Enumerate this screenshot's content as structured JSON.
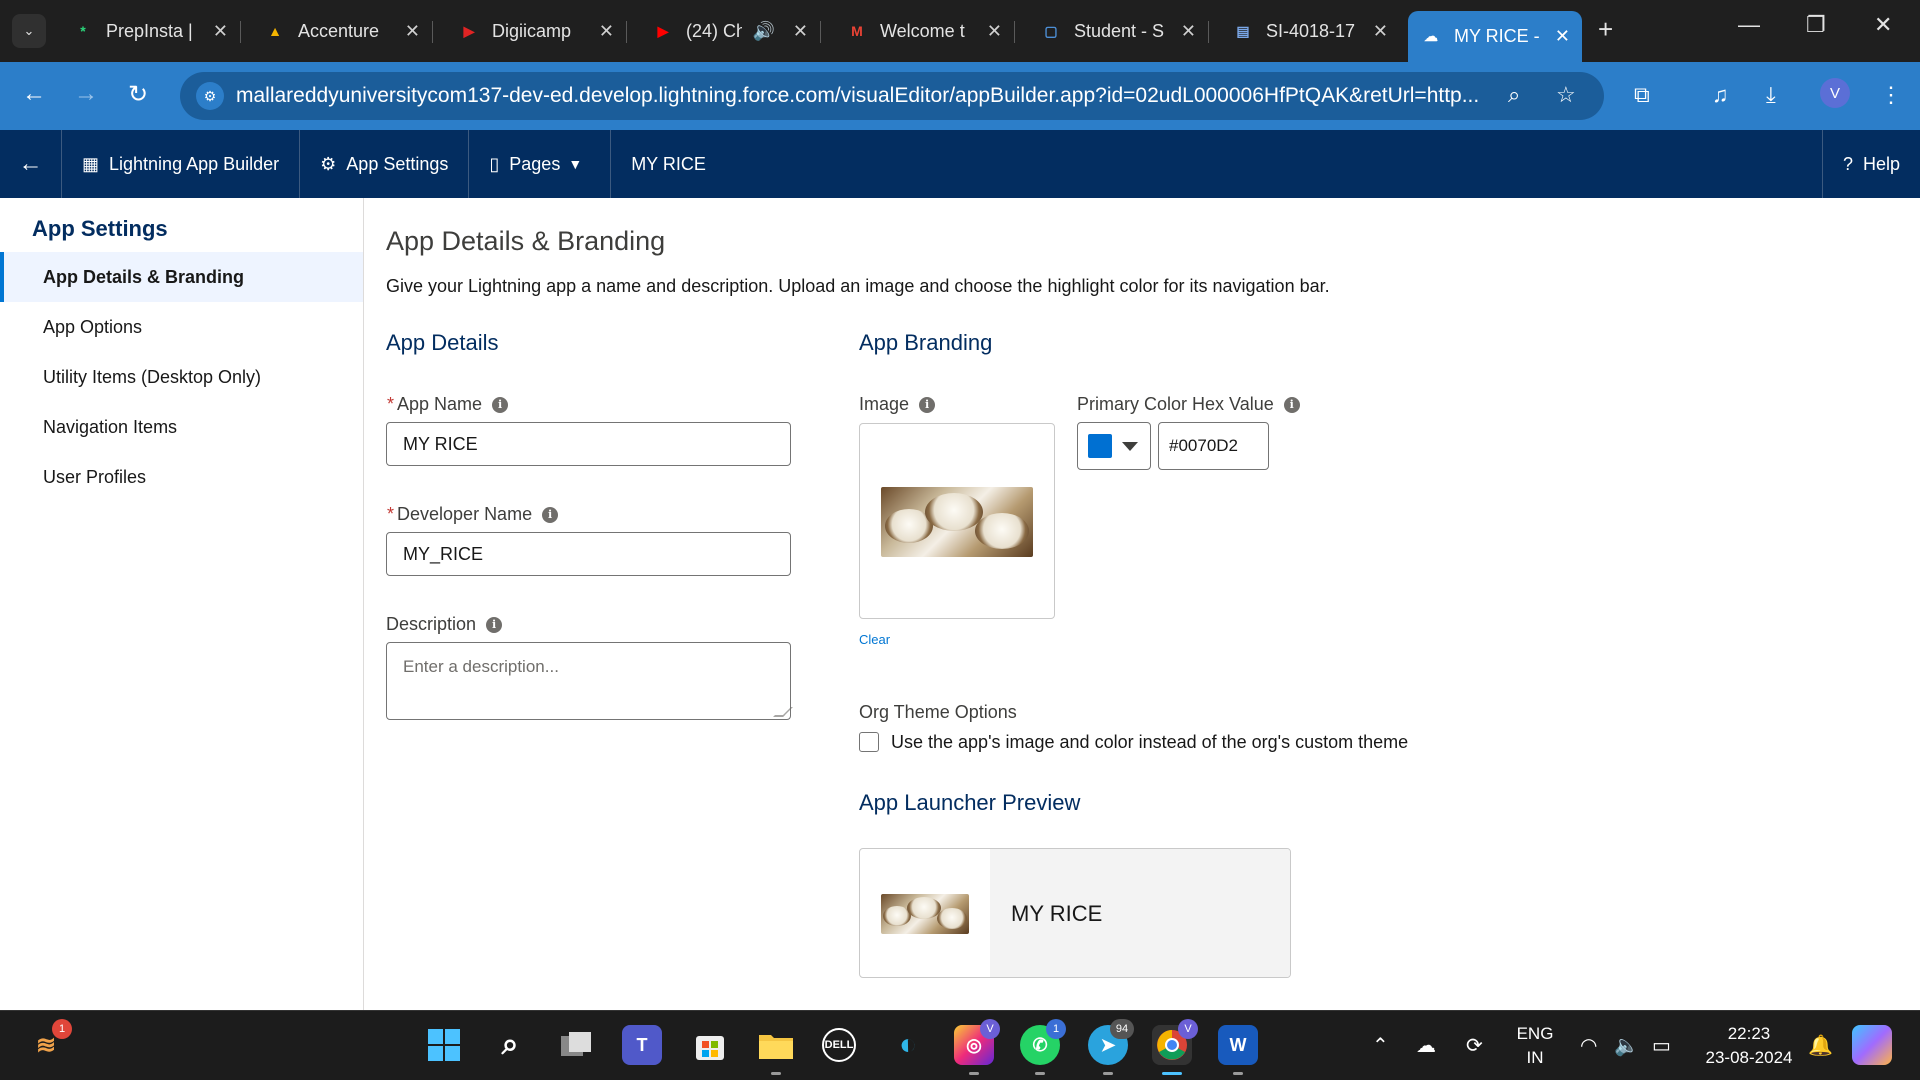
{
  "browser": {
    "tabs": [
      {
        "title": "PrepInsta |",
        "favicon": "*",
        "color": "#2bd67b"
      },
      {
        "title": "Accenture",
        "favicon": "▲",
        "color": "#f4b400"
      },
      {
        "title": "Digiicamp",
        "favicon": "▶",
        "color": "#e02424"
      },
      {
        "title": "(24) Ch",
        "favicon": "▶",
        "color": "#ff0000"
      },
      {
        "title": "Welcome t",
        "favicon": "M",
        "color": "#ea4335"
      },
      {
        "title": "Student - S",
        "favicon": "▢",
        "color": "#4d8fd6"
      },
      {
        "title": "SI-4018-17",
        "favicon": "▤",
        "color": "#7aa7e8"
      },
      {
        "title": "MY RICE -",
        "favicon": "☁",
        "color": "#ffffff"
      }
    ],
    "url": "mallareddyuniversitycom137-dev-ed.develop.lightning.force.com/visualEditor/appBuilder.app?id=02udL000006HfPtQAK&retUrl=http...",
    "profile_initial": "V"
  },
  "header": {
    "app_builder": "Lightning App Builder",
    "app_settings": "App Settings",
    "pages": "Pages",
    "app_name": "MY RICE",
    "help": "Help"
  },
  "sidebar": {
    "title": "App Settings",
    "items": [
      {
        "label": "App Details & Branding",
        "active": true
      },
      {
        "label": "App Options",
        "active": false
      },
      {
        "label": "Utility Items (Desktop Only)",
        "active": false
      },
      {
        "label": "Navigation Items",
        "active": false
      },
      {
        "label": "User Profiles",
        "active": false
      }
    ]
  },
  "main": {
    "title": "App Details & Branding",
    "description": "Give your Lightning app a name and description. Upload an image and choose the highlight color for its navigation bar.",
    "details": {
      "heading": "App Details",
      "app_name_label": "App Name",
      "app_name_value": "MY RICE",
      "developer_name_label": "Developer Name",
      "developer_name_value": "MY_RICE",
      "description_label": "Description",
      "description_placeholder": "Enter a description..."
    },
    "branding": {
      "heading": "App Branding",
      "image_label": "Image",
      "clear": "Clear",
      "color_label": "Primary Color Hex Value",
      "color_value": "#0070D2",
      "org_theme_label": "Org Theme Options",
      "org_theme_checkbox": "Use the app's image and color instead of the org's custom theme",
      "org_theme_checked": false,
      "preview_heading": "App Launcher Preview",
      "preview_name": "MY RICE"
    }
  },
  "taskbar": {
    "apps": [
      "start",
      "search",
      "task-view",
      "teams",
      "store",
      "file-explorer",
      "dell",
      "edge",
      "instagram",
      "whatsapp",
      "telegram",
      "chrome",
      "word"
    ],
    "badges": {
      "weather": "1",
      "instagram": "V",
      "whatsapp": "1",
      "telegram": "94",
      "chrome": "V"
    },
    "lang_top": "ENG",
    "lang_bottom": "IN",
    "time": "22:23",
    "date": "23-08-2024"
  }
}
